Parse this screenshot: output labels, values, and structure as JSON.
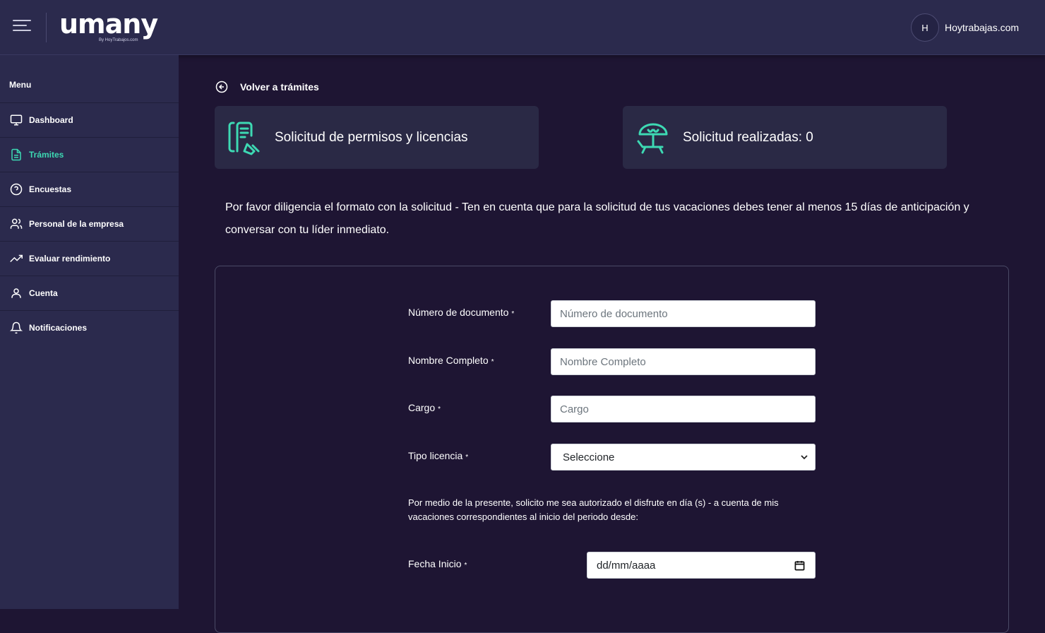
{
  "header": {
    "logo_text": "umany",
    "logo_sub": "By HoyTrabajos.com",
    "user_initial": "H",
    "user_name": "Hoytrabajas.com"
  },
  "sidebar": {
    "title": "Menu",
    "items": [
      {
        "label": "Dashboard",
        "icon": "monitor-icon",
        "active": false
      },
      {
        "label": "Trámites",
        "icon": "document-icon",
        "active": true
      },
      {
        "label": "Encuestas",
        "icon": "question-circle-icon",
        "active": false
      },
      {
        "label": "Personal de la empresa",
        "icon": "users-icon",
        "active": false
      },
      {
        "label": "Evaluar rendimiento",
        "icon": "trending-up-icon",
        "active": false
      },
      {
        "label": "Cuenta",
        "icon": "user-icon",
        "active": false
      },
      {
        "label": "Notificaciones",
        "icon": "bell-icon",
        "active": false
      }
    ]
  },
  "main": {
    "back_label": "Volver a trámites",
    "cards": [
      {
        "title": "Solicitud de permisos y licencias",
        "icon": "document-edit-icon"
      },
      {
        "title": "Solicitud realizadas: 0",
        "icon": "beach-umbrella-icon"
      }
    ],
    "intro": "Por favor diligencia el formato con la solicitud - Ten en cuenta que para la solicitud de tus vacaciones debes tener al menos 15 días de anticipación y conversar con tu líder inmediato.",
    "form": {
      "required_mark": "*",
      "documento_label": "Número de documento",
      "documento_placeholder": "Número de documento",
      "nombre_label": "Nombre Completo",
      "nombre_placeholder": "Nombre Completo",
      "cargo_label": "Cargo",
      "cargo_placeholder": "Cargo",
      "tipo_label": "Tipo licencia",
      "tipo_selected": "Seleccione",
      "paragraph": "Por medio de la presente, solicito me sea autorizado el disfrute en día (s) - a cuenta de mis vacaciones correspondientes al inicio del periodo desde:",
      "fecha_inicio_label": "Fecha Inicio",
      "fecha_inicio_value": "dd/mm/aaaa"
    }
  },
  "colors": {
    "accent": "#3dd9b3",
    "background": "#1e1533",
    "panel": "#2b2a4d",
    "card": "#2a2945"
  }
}
